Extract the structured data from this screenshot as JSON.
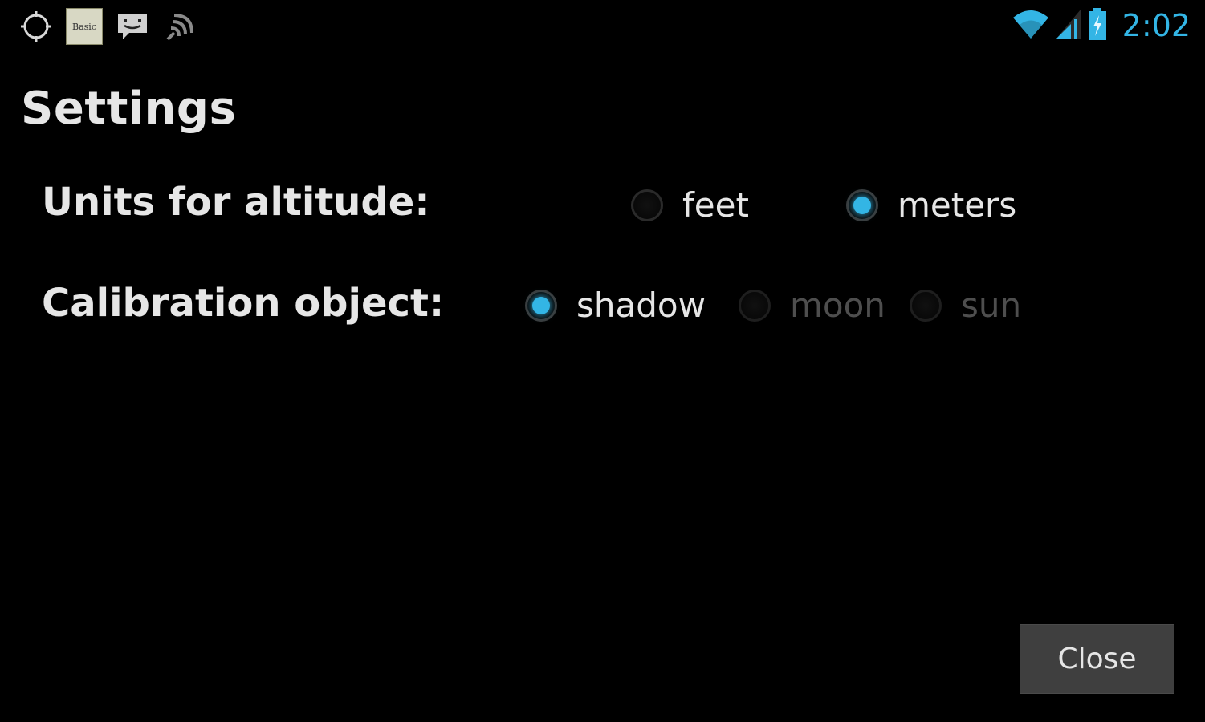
{
  "status_bar": {
    "left_icons": [
      "gps-icon",
      "notification-app-thumbnail",
      "sms-icon",
      "signal-broadcast-icon"
    ],
    "notification_thumb_text": "Basic",
    "right_icons": [
      "wifi-icon",
      "cell-signal-icon",
      "battery-charging-icon"
    ],
    "time": "2:02",
    "accent_color": "#33b5e5"
  },
  "settings": {
    "title": "Settings",
    "altitude": {
      "label": "Units for altitude:",
      "options": [
        {
          "label": "feet",
          "selected": false,
          "enabled": true
        },
        {
          "label": "meters",
          "selected": true,
          "enabled": true
        }
      ]
    },
    "calibration": {
      "label": "Calibration object:",
      "options": [
        {
          "label": "shadow",
          "selected": true,
          "enabled": true
        },
        {
          "label": "moon",
          "selected": false,
          "enabled": false
        },
        {
          "label": "sun",
          "selected": false,
          "enabled": false
        }
      ]
    }
  },
  "actions": {
    "close_label": "Close"
  }
}
